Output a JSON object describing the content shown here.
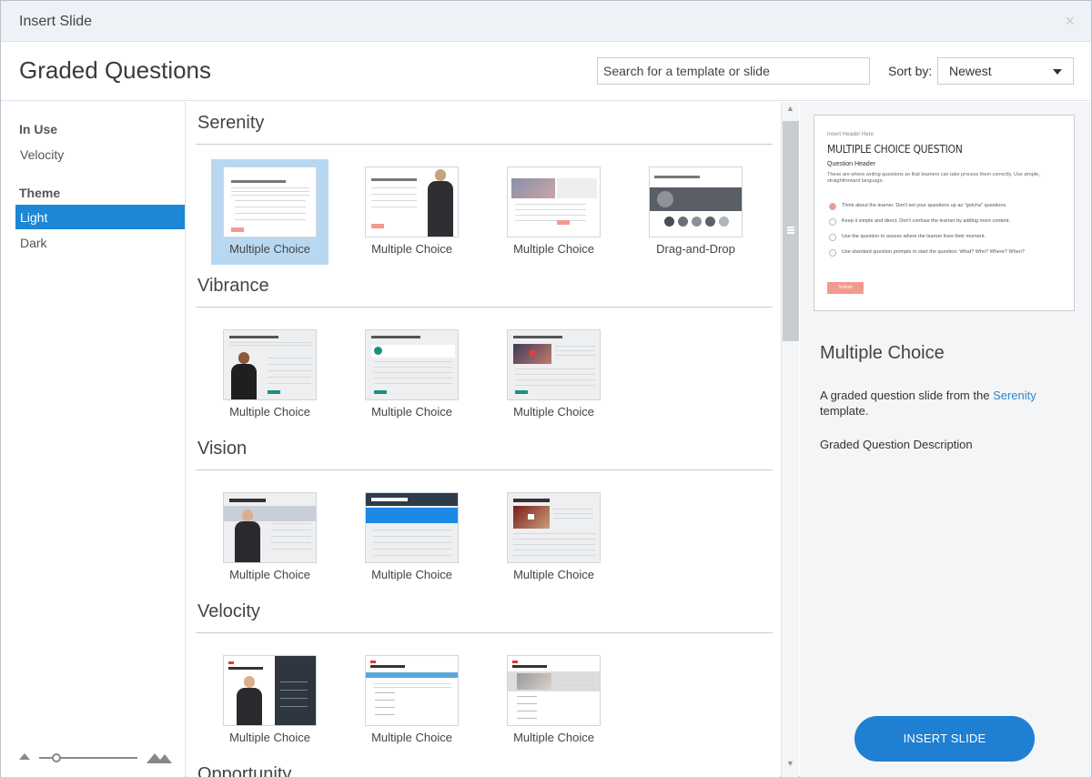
{
  "window": {
    "title": "Insert Slide",
    "close_glyph": "×"
  },
  "header": {
    "title": "Graded Questions",
    "search_placeholder": "Search for a template or slide",
    "sort_label": "Sort by:",
    "sort_value": "Newest"
  },
  "sidebar": {
    "in_use_heading": "In Use",
    "in_use_items": [
      "Velocity"
    ],
    "theme_heading": "Theme",
    "theme_items": [
      {
        "label": "Light",
        "active": true
      },
      {
        "label": "Dark",
        "active": false
      }
    ],
    "zoom_level": 0.18
  },
  "sections": [
    {
      "title": "Serenity",
      "cards": [
        {
          "label": "Multiple Choice",
          "selected": true,
          "thumb": "serenity-1"
        },
        {
          "label": "Multiple Choice",
          "selected": false,
          "thumb": "serenity-2"
        },
        {
          "label": "Multiple Choice",
          "selected": false,
          "thumb": "serenity-3"
        },
        {
          "label": "Drag-and-Drop",
          "selected": false,
          "thumb": "serenity-4"
        }
      ]
    },
    {
      "title": "Vibrance",
      "cards": [
        {
          "label": "Multiple Choice",
          "selected": false,
          "thumb": "vibrance-1"
        },
        {
          "label": "Multiple Choice",
          "selected": false,
          "thumb": "vibrance-2"
        },
        {
          "label": "Multiple Choice",
          "selected": false,
          "thumb": "vibrance-3"
        }
      ]
    },
    {
      "title": "Vision",
      "cards": [
        {
          "label": "Multiple Choice",
          "selected": false,
          "thumb": "vision-1"
        },
        {
          "label": "Multiple Choice",
          "selected": false,
          "thumb": "vision-2"
        },
        {
          "label": "Multiple Choice",
          "selected": false,
          "thumb": "vision-3"
        }
      ]
    },
    {
      "title": "Velocity",
      "cards": [
        {
          "label": "Multiple Choice",
          "selected": false,
          "thumb": "velocity-1"
        },
        {
          "label": "Multiple Choice",
          "selected": false,
          "thumb": "velocity-2"
        },
        {
          "label": "Multiple Choice",
          "selected": false,
          "thumb": "velocity-3"
        }
      ]
    },
    {
      "title": "Opportunity",
      "cards": []
    }
  ],
  "preview": {
    "slide": {
      "header_small": "Insert Header Here",
      "title": "MULTIPLE CHOICE QUESTION",
      "question_header": "Question Header",
      "prompt": "These are where writing questions so that learners can take process them correctly. Use simple, straightforward language.",
      "options": [
        "Think about the learner. Don't set your questions up as \"gotcha\" questions.",
        "Keep it simple and direct. Don't confuse the learner by adding more content.",
        "Use the question to assess where the learner lives their moment.",
        "Use standard question prompts to start the question: What? Who? Where? When?"
      ],
      "submit": "Submit"
    },
    "name": "Multiple Choice",
    "description_prefix": "A graded question slide from the ",
    "description_link": "Serenity",
    "description_suffix": " template.",
    "graded_description": "Graded Question Description",
    "insert_button": "INSERT SLIDE"
  },
  "colors": {
    "accent": "#1e86d6",
    "button": "#1e7fd3",
    "selected_card": "#b8d8f2",
    "submit": "#f29a8f",
    "link": "#2c87d2"
  }
}
